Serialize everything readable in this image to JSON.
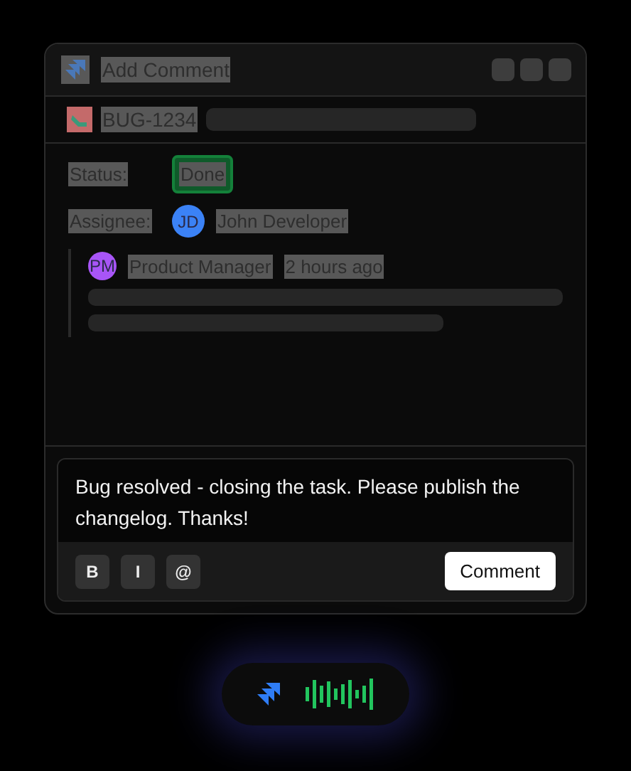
{
  "window": {
    "title": "Add Comment"
  },
  "issue": {
    "key": "BUG-1234"
  },
  "details": {
    "status_label": "Status:",
    "status": "Done",
    "assignee_label": "Assignee:",
    "assignee_initials": "JD",
    "assignee_name": "John Developer"
  },
  "previous_comment": {
    "author_initials": "PM",
    "author": "Product Manager",
    "time": "2 hours ago"
  },
  "composer": {
    "value": "Bug resolved - closing the task. Please publish the changelog. Thanks!",
    "format_buttons": [
      "B",
      "I",
      "@"
    ],
    "submit": "Comment"
  },
  "voice_pill": {
    "listening": true
  }
}
